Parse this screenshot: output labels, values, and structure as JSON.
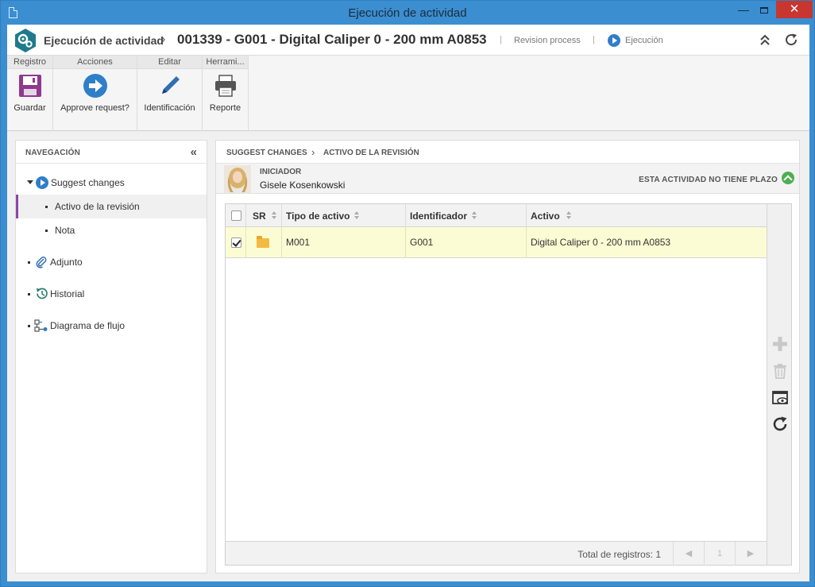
{
  "window": {
    "title": "Ejecución de actividad"
  },
  "header": {
    "module": "Ejecución de actividad",
    "separator": "›",
    "record": "001339 - G001 - Digital Caliper 0 - 200 mm A0853",
    "pipe": "|",
    "process": "Revision process",
    "status": "Ejecución"
  },
  "ribbon": {
    "groups": [
      {
        "title": "Registro",
        "button": "Guardar"
      },
      {
        "title": "Acciones",
        "button": "Approve request?"
      },
      {
        "title": "Editar",
        "button": "Identificación"
      },
      {
        "title": "Herrami...",
        "button": "Reporte"
      }
    ]
  },
  "nav": {
    "title": "NAVEGACIÓN",
    "collapse": "«",
    "items": [
      {
        "label": "Suggest changes"
      },
      {
        "label": "Activo de la revisión"
      },
      {
        "label": "Nota"
      },
      {
        "label": "Adjunto"
      },
      {
        "label": "Historial"
      },
      {
        "label": "Diagrama de flujo"
      }
    ]
  },
  "main": {
    "breadcrumb": [
      "SUGGEST CHANGES",
      "ACTIVO DE LA REVISIÓN"
    ],
    "breadcrumb_sep": "›",
    "initiator_label": "INICIADOR",
    "initiator_name": "Gisele Kosenkowski",
    "deadline": "ESTA ACTIVIDAD NO TIENE PLAZO"
  },
  "grid": {
    "columns": [
      "SR",
      "Tipo de activo",
      "Identificador",
      "Activo"
    ],
    "rows": [
      {
        "checked": true,
        "tipo": "M001",
        "identificador": "G001",
        "activo": "Digital Caliper 0 - 200 mm A0853"
      }
    ],
    "total_label": "Total de registros: 1",
    "page": "1",
    "prev": "◀",
    "next": "▶"
  }
}
